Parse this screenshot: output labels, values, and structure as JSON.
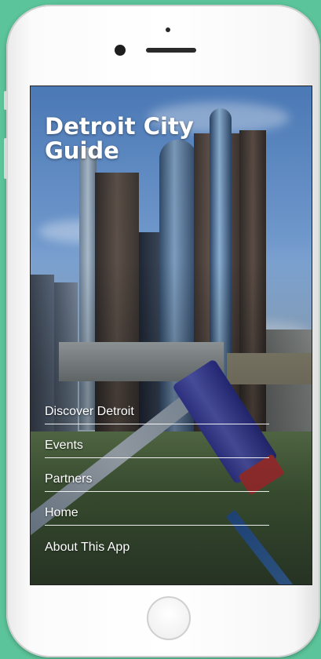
{
  "colors": {
    "background": "#5cc49a",
    "menu_text": "#ffffff"
  },
  "app": {
    "title": "Detroit City\nGuide"
  },
  "menu": {
    "items": [
      {
        "label": "Discover Detroit"
      },
      {
        "label": "Events"
      },
      {
        "label": "Partners"
      },
      {
        "label": "Home"
      },
      {
        "label": "About This App"
      }
    ]
  },
  "icons": {
    "home_button": "home-button-icon"
  }
}
